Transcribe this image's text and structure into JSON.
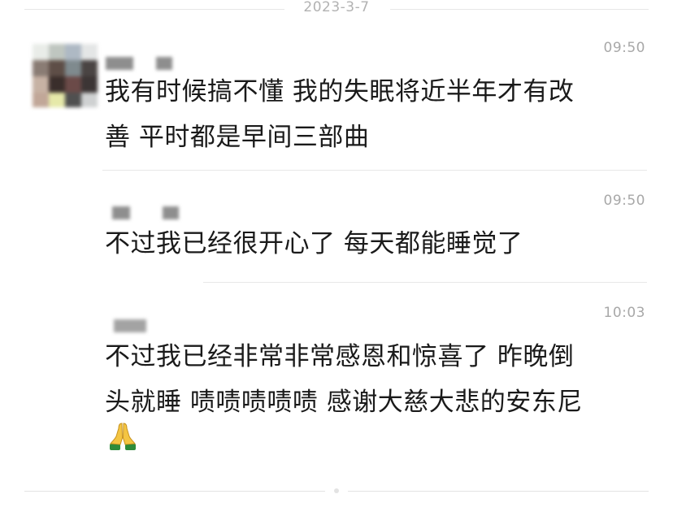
{
  "date_separator": "2023-3-7",
  "messages": [
    {
      "time": "09:50",
      "text_lines": [
        "我有时候搞不懂 我的失眠将近半年才有改",
        "善 平时都是早间三部曲"
      ]
    },
    {
      "time": "09:50",
      "text_lines": [
        "不过我已经很开心了 每天都能睡觉了"
      ]
    },
    {
      "time": "10:03",
      "text_lines": [
        "不过我已经非常非常感恩和惊喜了 昨晚倒",
        "头就睡 啧啧啧啧啧 感谢大慈大悲的安东尼"
      ],
      "emoji": "folded-hands"
    }
  ],
  "colors": {
    "text": "#1a1a1a",
    "timestamp": "#a8a8a8",
    "divider": "#e8e8e8"
  }
}
